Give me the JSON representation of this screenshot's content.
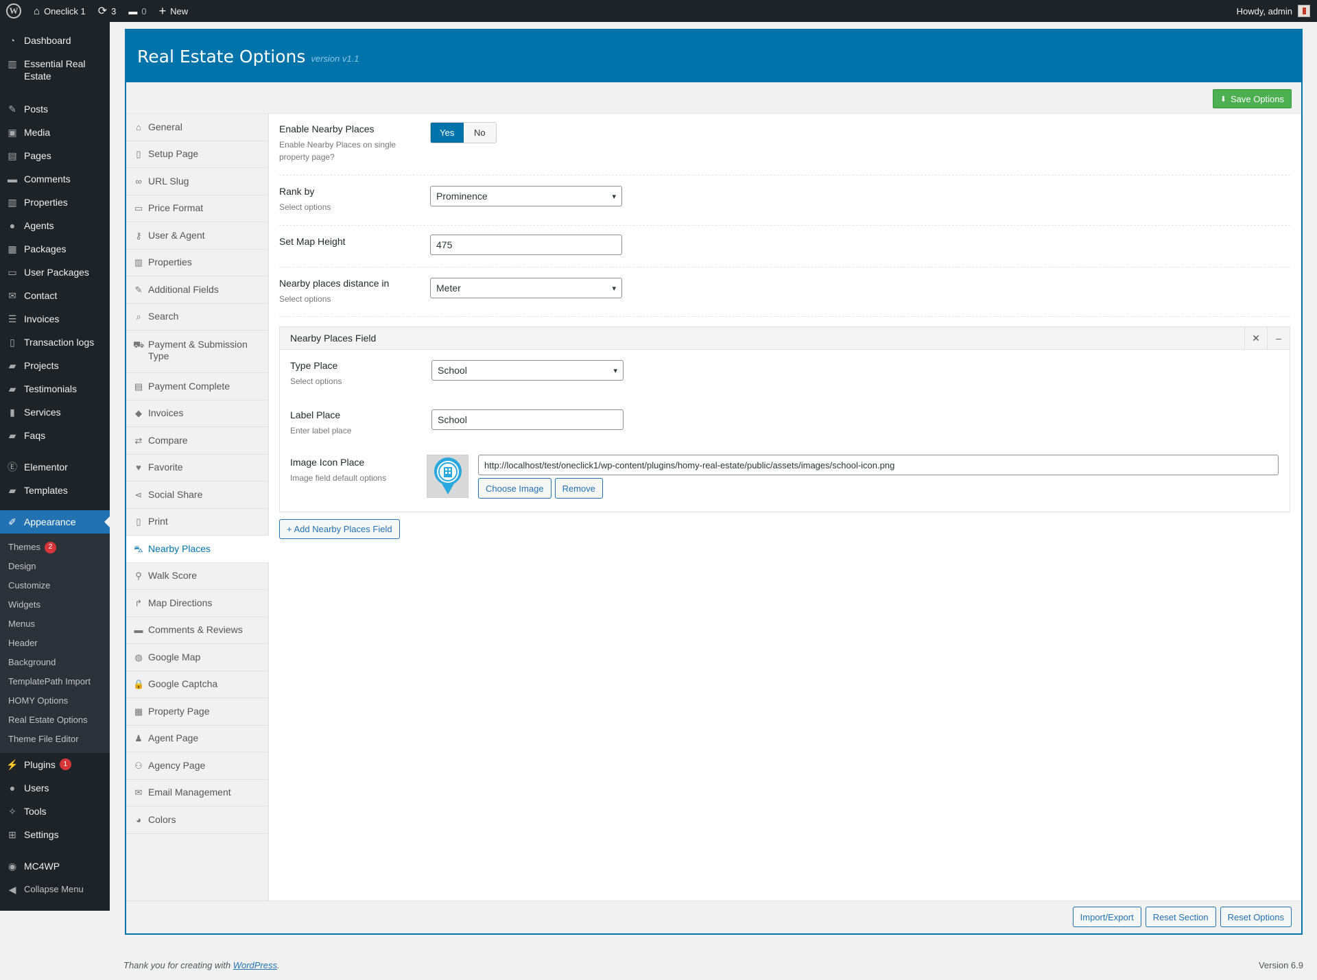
{
  "adminbar": {
    "site_name": "Oneclick 1",
    "updates_count": "3",
    "comments_count": "0",
    "new_label": "New",
    "howdy": "Howdy, admin"
  },
  "sidebar": {
    "items": [
      {
        "label": "Dashboard",
        "icon": "dashboard-icon"
      },
      {
        "label": "Essential Real Estate",
        "icon": "building-icon"
      },
      {
        "label": "Posts",
        "icon": "pin-icon"
      },
      {
        "label": "Media",
        "icon": "media-icon"
      },
      {
        "label": "Pages",
        "icon": "pages-icon"
      },
      {
        "label": "Comments",
        "icon": "comment-icon"
      },
      {
        "label": "Properties",
        "icon": "building-icon"
      },
      {
        "label": "Agents",
        "icon": "user-icon"
      },
      {
        "label": "Packages",
        "icon": "grid-icon"
      },
      {
        "label": "User Packages",
        "icon": "id-card-icon"
      },
      {
        "label": "Contact",
        "icon": "email-icon"
      },
      {
        "label": "Invoices",
        "icon": "list-icon"
      },
      {
        "label": "Transaction logs",
        "icon": "document-icon"
      },
      {
        "label": "Projects",
        "icon": "folder-icon"
      },
      {
        "label": "Testimonials",
        "icon": "folder-icon"
      },
      {
        "label": "Services",
        "icon": "briefcase-icon"
      },
      {
        "label": "Faqs",
        "icon": "folder-icon"
      },
      {
        "label": "Elementor",
        "icon": "elementor-icon"
      },
      {
        "label": "Templates",
        "icon": "folder-icon"
      },
      {
        "label": "Appearance",
        "icon": "paintbrush-icon"
      }
    ],
    "appearance_sub": [
      {
        "label": "Themes",
        "badge": "2"
      },
      {
        "label": "Design"
      },
      {
        "label": "Customize"
      },
      {
        "label": "Widgets"
      },
      {
        "label": "Menus"
      },
      {
        "label": "Header"
      },
      {
        "label": "Background"
      },
      {
        "label": "TemplatePath Import"
      },
      {
        "label": "HOMY Options"
      },
      {
        "label": "Real Estate Options"
      },
      {
        "label": "Theme File Editor"
      }
    ],
    "bottom_items": [
      {
        "label": "Plugins",
        "icon": "plugin-icon",
        "badge": "1"
      },
      {
        "label": "Users",
        "icon": "users-icon"
      },
      {
        "label": "Tools",
        "icon": "wrench-icon"
      },
      {
        "label": "Settings",
        "icon": "settings-icon"
      },
      {
        "label": "MC4WP",
        "icon": "mc4wp-icon"
      },
      {
        "label": "Collapse Menu",
        "icon": "collapse-icon"
      }
    ]
  },
  "panel": {
    "title": "Real Estate Options",
    "version": "version v1.1",
    "save_label": "Save Options"
  },
  "tabs": [
    {
      "label": "General",
      "icon": "home-icon"
    },
    {
      "label": "Setup Page",
      "icon": "document-icon"
    },
    {
      "label": "URL Slug",
      "icon": "link-icon"
    },
    {
      "label": "Price Format",
      "icon": "money-icon"
    },
    {
      "label": "User & Agent",
      "icon": "key-icon"
    },
    {
      "label": "Properties",
      "icon": "building-icon"
    },
    {
      "label": "Additional Fields",
      "icon": "edit-icon"
    },
    {
      "label": "Search",
      "icon": "search-icon"
    },
    {
      "label": "Payment & Submission Type",
      "icon": "cart-icon"
    },
    {
      "label": "Payment Complete",
      "icon": "credit-card-icon"
    },
    {
      "label": "Invoices",
      "icon": "tag-icon"
    },
    {
      "label": "Compare",
      "icon": "compare-icon"
    },
    {
      "label": "Favorite",
      "icon": "heart-icon"
    },
    {
      "label": "Social Share",
      "icon": "share-icon"
    },
    {
      "label": "Print",
      "icon": "print-icon"
    },
    {
      "label": "Nearby Places",
      "icon": "car-icon"
    },
    {
      "label": "Walk Score",
      "icon": "location-icon"
    },
    {
      "label": "Map Directions",
      "icon": "directions-icon"
    },
    {
      "label": "Comments & Reviews",
      "icon": "comment-icon"
    },
    {
      "label": "Google Map",
      "icon": "globe-icon"
    },
    {
      "label": "Google Captcha",
      "icon": "lock-icon"
    },
    {
      "label": "Property Page",
      "icon": "table-icon"
    },
    {
      "label": "Agent Page",
      "icon": "agent-icon"
    },
    {
      "label": "Agency Page",
      "icon": "group-icon"
    },
    {
      "label": "Email Management",
      "icon": "email-icon"
    },
    {
      "label": "Colors",
      "icon": "palette-icon"
    }
  ],
  "fields": {
    "enable_nearby": {
      "label": "Enable Nearby Places",
      "desc": "Enable Nearby Places on single property page?",
      "yes": "Yes",
      "no": "No",
      "value": "Yes"
    },
    "rank_by": {
      "label": "Rank by",
      "desc": "Select options",
      "value": "Prominence"
    },
    "map_height": {
      "label": "Set Map Height",
      "value": "475"
    },
    "distance": {
      "label": "Nearby places distance in",
      "desc": "Select options",
      "value": "Meter"
    }
  },
  "repeater": {
    "title": "Nearby Places Field",
    "close": "✕",
    "collapse": "–",
    "type_place": {
      "label": "Type Place",
      "desc": "Select options",
      "value": "School"
    },
    "label_place": {
      "label": "Label Place",
      "desc": "Enter label place",
      "value": "School"
    },
    "image_icon": {
      "label": "Image Icon Place",
      "desc": "Image field default options",
      "url": "http://localhost/test/oneclick1/wp-content/plugins/homy-real-estate/public/assets/images/school-icon.png",
      "choose": "Choose Image",
      "remove": "Remove"
    },
    "add_label": "+ Add Nearby Places Field"
  },
  "footer_buttons": [
    "Import/Export",
    "Reset Section",
    "Reset Options"
  ],
  "wpfooter": {
    "thanks_prefix": "Thank you for creating with ",
    "wp_link": "WordPress",
    "thanks_suffix": ".",
    "version": "Version 6.9"
  },
  "colors": {
    "accent": "#0073aa",
    "save": "#4caf50",
    "sidebar": "#1d2327",
    "badge": "#d63638"
  }
}
